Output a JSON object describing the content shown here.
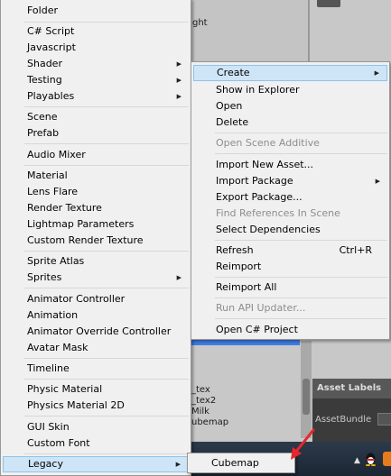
{
  "background": {
    "fragments": [
      "ght",
      "_tex",
      "_tex2",
      "Milk",
      "ubemap"
    ],
    "asset_labels": "Asset Labels",
    "asset_bundle": "AssetBundle"
  },
  "main_menu": {
    "items": [
      {
        "label": "Folder"
      },
      {
        "label": "C# Script"
      },
      {
        "label": "Javascript"
      },
      {
        "label": "Shader"
      },
      {
        "label": "Testing"
      },
      {
        "label": "Playables"
      },
      {
        "label": "Scene"
      },
      {
        "label": "Prefab"
      },
      {
        "label": "Audio Mixer"
      },
      {
        "label": "Material"
      },
      {
        "label": "Lens Flare"
      },
      {
        "label": "Render Texture"
      },
      {
        "label": "Lightmap Parameters"
      },
      {
        "label": "Custom Render Texture"
      },
      {
        "label": "Sprite Atlas"
      },
      {
        "label": "Sprites"
      },
      {
        "label": "Animator Controller"
      },
      {
        "label": "Animation"
      },
      {
        "label": "Animator Override Controller"
      },
      {
        "label": "Avatar Mask"
      },
      {
        "label": "Timeline"
      },
      {
        "label": "Physic Material"
      },
      {
        "label": "Physics Material 2D"
      },
      {
        "label": "GUI Skin"
      },
      {
        "label": "Custom Font"
      },
      {
        "label": "Legacy"
      }
    ]
  },
  "context_menu": {
    "items": [
      {
        "label": "Create"
      },
      {
        "label": "Show in Explorer"
      },
      {
        "label": "Open"
      },
      {
        "label": "Delete"
      },
      {
        "label": "Open Scene Additive"
      },
      {
        "label": "Import New Asset..."
      },
      {
        "label": "Import Package"
      },
      {
        "label": "Export Package..."
      },
      {
        "label": "Find References In Scene"
      },
      {
        "label": "Select Dependencies"
      },
      {
        "label": "Refresh",
        "shortcut": "Ctrl+R"
      },
      {
        "label": "Reimport"
      },
      {
        "label": "Reimport All"
      },
      {
        "label": "Run API Updater..."
      },
      {
        "label": "Open C# Project"
      }
    ]
  },
  "legacy_menu": {
    "items": [
      {
        "label": "Cubemap"
      }
    ]
  },
  "colors": {
    "menu_bg": "#f0f0f0",
    "highlight_bg": "#cde5f7",
    "highlight_border": "#8fc3ea",
    "disabled_text": "#8d8d8d",
    "annotation_arrow": "#e8262a"
  }
}
